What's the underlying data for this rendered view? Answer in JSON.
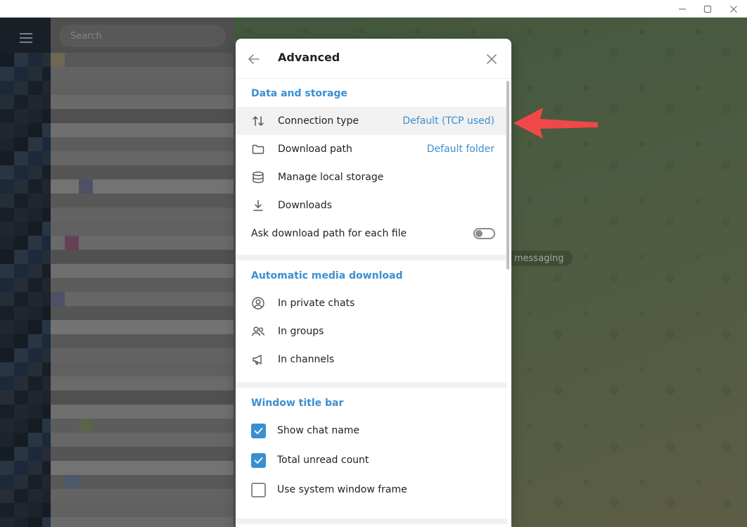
{
  "window": {
    "minimize_icon": "minimize-icon",
    "maximize_icon": "maximize-icon",
    "close_icon": "close-icon"
  },
  "sidebar": {
    "search_placeholder": "Search"
  },
  "chat_background": {
    "pill_text": "messaging"
  },
  "modal": {
    "title": "Advanced",
    "sections": {
      "data_storage": {
        "title": "Data and storage",
        "connection_type": {
          "label": "Connection type",
          "value": "Default (TCP used)"
        },
        "download_path": {
          "label": "Download path",
          "value": "Default folder"
        },
        "manage_storage": {
          "label": "Manage local storage"
        },
        "downloads": {
          "label": "Downloads"
        },
        "ask_path": {
          "label": "Ask download path for each file",
          "enabled": false
        }
      },
      "auto_media": {
        "title": "Automatic media download",
        "private": {
          "label": "In private chats"
        },
        "groups": {
          "label": "In groups"
        },
        "channels": {
          "label": "In channels"
        }
      },
      "title_bar": {
        "title": "Window title bar",
        "show_chat_name": {
          "label": "Show chat name",
          "checked": true
        },
        "total_unread": {
          "label": "Total unread count",
          "checked": true
        },
        "system_frame": {
          "label": "Use system window frame",
          "checked": false
        }
      }
    }
  },
  "colors": {
    "accent": "#3a8fd1",
    "annotation_arrow": "#f04848",
    "dialog_bg": "#ffffff"
  }
}
